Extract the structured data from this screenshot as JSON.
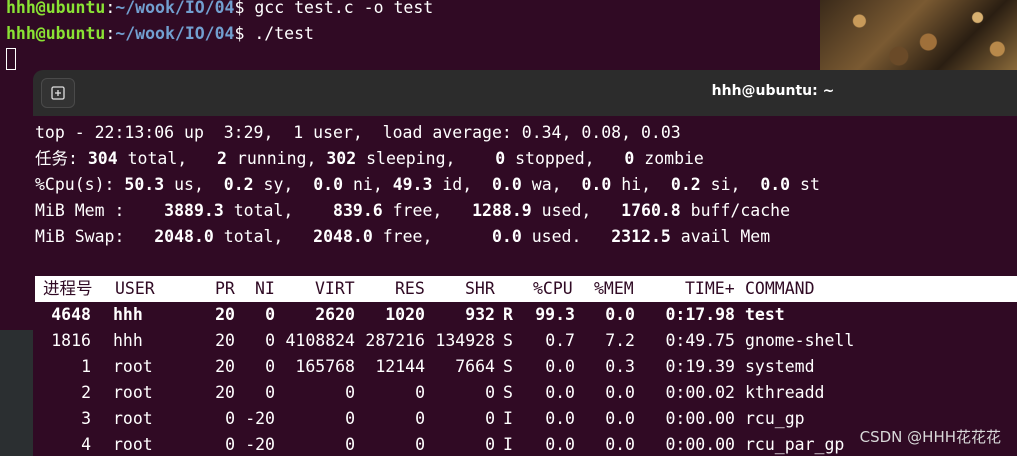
{
  "background_terminal": {
    "lines": [
      {
        "user": "hhh@ubuntu",
        "sep": ":",
        "path": "~/wook/IO/04",
        "dollar": "$ ",
        "cmd": "gcc test.c -o test"
      },
      {
        "user": "hhh@ubuntu",
        "sep": ":",
        "path": "~/wook/IO/04",
        "dollar": "$ ",
        "cmd": "./test"
      }
    ]
  },
  "window": {
    "title": "hhh@ubuntu: ~"
  },
  "top_summary": {
    "line1": "top - 22:13:06 up  3:29,  1 user,  load average: 0.34, 0.08, 0.03",
    "tasks": {
      "label": "任务:",
      "total": "304",
      "total_l": " total,",
      "running": "2",
      "running_l": " running,",
      "sleeping": "302",
      "sleeping_l": " sleeping,",
      "stopped": "0",
      "stopped_l": " stopped,",
      "zombie": "0",
      "zombie_l": " zombie"
    },
    "cpu": {
      "label": "%Cpu(s):",
      "us": "50.3",
      "sy": "0.2",
      "ni": "0.0",
      "id": "49.3",
      "wa": "0.0",
      "hi": "0.0",
      "si": "0.2",
      "st": "0.0"
    },
    "mem": {
      "label": "MiB Mem :",
      "total": "3889.3",
      "free": "839.6",
      "used": "1288.9",
      "buff": "1760.8"
    },
    "swap": {
      "label": "MiB Swap:",
      "total": "2048.0",
      "free": "2048.0",
      "used": "0.0",
      "avail": "2312.5"
    }
  },
  "columns": [
    "进程号",
    "USER",
    "PR",
    "NI",
    "VIRT",
    "RES",
    "SHR",
    "",
    "%CPU",
    "%MEM",
    "TIME+",
    "COMMAND"
  ],
  "processes": [
    {
      "pid": "4648",
      "user": "hhh",
      "pr": "20",
      "ni": "0",
      "virt": "2620",
      "res": "1020",
      "shr": "932",
      "s": "R",
      "cpu": "99.3",
      "mem": "0.0",
      "time": "0:17.98",
      "cmd": "test"
    },
    {
      "pid": "1816",
      "user": "hhh",
      "pr": "20",
      "ni": "0",
      "virt": "4108824",
      "res": "287216",
      "shr": "134928",
      "s": "S",
      "cpu": "0.7",
      "mem": "7.2",
      "time": "0:49.75",
      "cmd": "gnome-shell"
    },
    {
      "pid": "1",
      "user": "root",
      "pr": "20",
      "ni": "0",
      "virt": "165768",
      "res": "12144",
      "shr": "7664",
      "s": "S",
      "cpu": "0.0",
      "mem": "0.3",
      "time": "0:19.39",
      "cmd": "systemd"
    },
    {
      "pid": "2",
      "user": "root",
      "pr": "20",
      "ni": "0",
      "virt": "0",
      "res": "0",
      "shr": "0",
      "s": "S",
      "cpu": "0.0",
      "mem": "0.0",
      "time": "0:00.02",
      "cmd": "kthreadd"
    },
    {
      "pid": "3",
      "user": "root",
      "pr": "0",
      "ni": "-20",
      "virt": "0",
      "res": "0",
      "shr": "0",
      "s": "I",
      "cpu": "0.0",
      "mem": "0.0",
      "time": "0:00.00",
      "cmd": "rcu_gp"
    },
    {
      "pid": "4",
      "user": "root",
      "pr": "0",
      "ni": "-20",
      "virt": "0",
      "res": "0",
      "shr": "0",
      "s": "I",
      "cpu": "0.0",
      "mem": "0.0",
      "time": "0:00.00",
      "cmd": "rcu_par_gp"
    }
  ],
  "watermark": "CSDN @HHH花花花",
  "colors": {
    "terminal_bg": "#300a24",
    "prompt_user": "#8ae234",
    "prompt_path": "#729fcf"
  }
}
